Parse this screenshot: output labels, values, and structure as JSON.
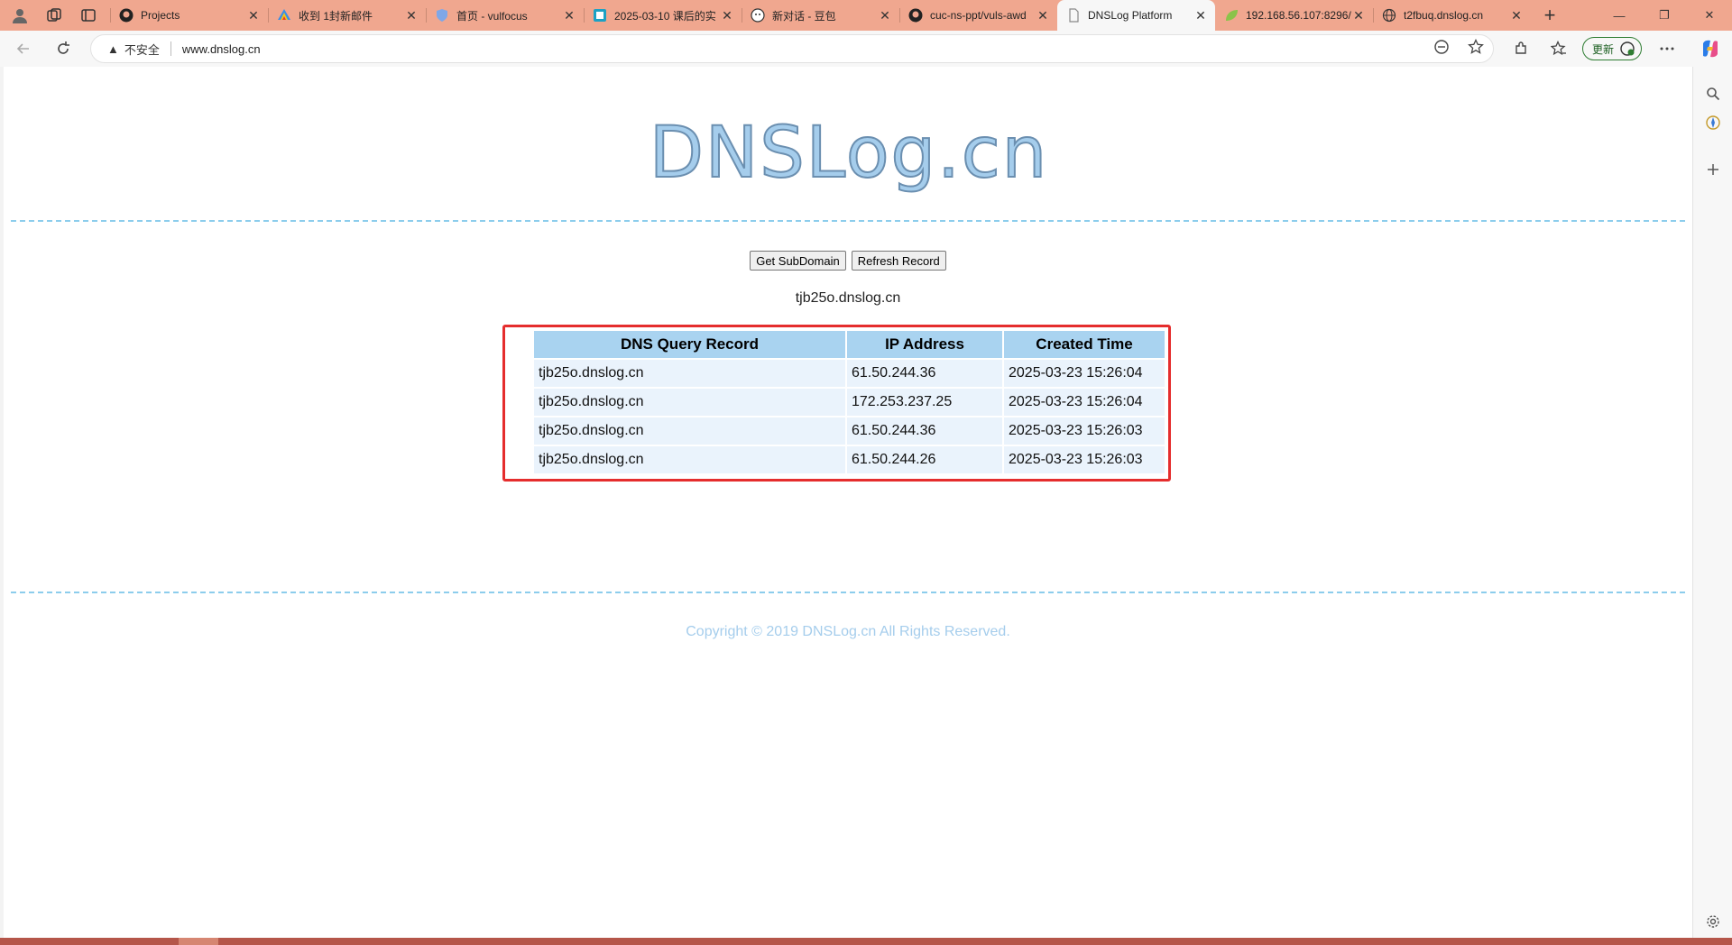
{
  "browser": {
    "tabs": [
      {
        "title": "Projects",
        "favicon": "github-icon",
        "active": false
      },
      {
        "title": "收到 1封新邮件",
        "favicon": "mail-icon",
        "active": false
      },
      {
        "title": "首页 - vulfocus",
        "favicon": "vulfocus-icon",
        "active": false
      },
      {
        "title": "2025-03-10 课后的实",
        "favicon": "doc-icon",
        "active": false
      },
      {
        "title": "新对话 - 豆包",
        "favicon": "doubao-icon",
        "active": false
      },
      {
        "title": "cuc-ns-ppt/vuls-awd",
        "favicon": "github-icon",
        "active": false
      },
      {
        "title": "DNSLog Platform",
        "favicon": "page-icon",
        "active": true
      },
      {
        "title": "192.168.56.107:8296/",
        "favicon": "leaf-icon",
        "active": false
      },
      {
        "title": "t2fbuq.dnslog.cn",
        "favicon": "globe-icon",
        "active": false
      }
    ],
    "address": {
      "security_label": "不安全",
      "url": "www.dnslog.cn"
    },
    "update_label": "更新",
    "accent_color": "#f0a78f"
  },
  "page": {
    "logo_text": "DNSLog.cn",
    "buttons": {
      "get_subdomain": "Get SubDomain",
      "refresh_record": "Refresh Record"
    },
    "subdomain": "tjb25o.dnslog.cn",
    "table": {
      "headers": [
        "DNS Query Record",
        "IP Address",
        "Created Time"
      ],
      "rows": [
        [
          "tjb25o.dnslog.cn",
          "61.50.244.36",
          "2025-03-23 15:26:04"
        ],
        [
          "tjb25o.dnslog.cn",
          "172.253.237.25",
          "2025-03-23 15:26:04"
        ],
        [
          "tjb25o.dnslog.cn",
          "61.50.244.36",
          "2025-03-23 15:26:03"
        ],
        [
          "tjb25o.dnslog.cn",
          "61.50.244.26",
          "2025-03-23 15:26:03"
        ]
      ]
    },
    "copyright": "Copyright © 2019 DNSLog.cn All Rights Reserved.",
    "highlight_color": "#e52d2d"
  }
}
